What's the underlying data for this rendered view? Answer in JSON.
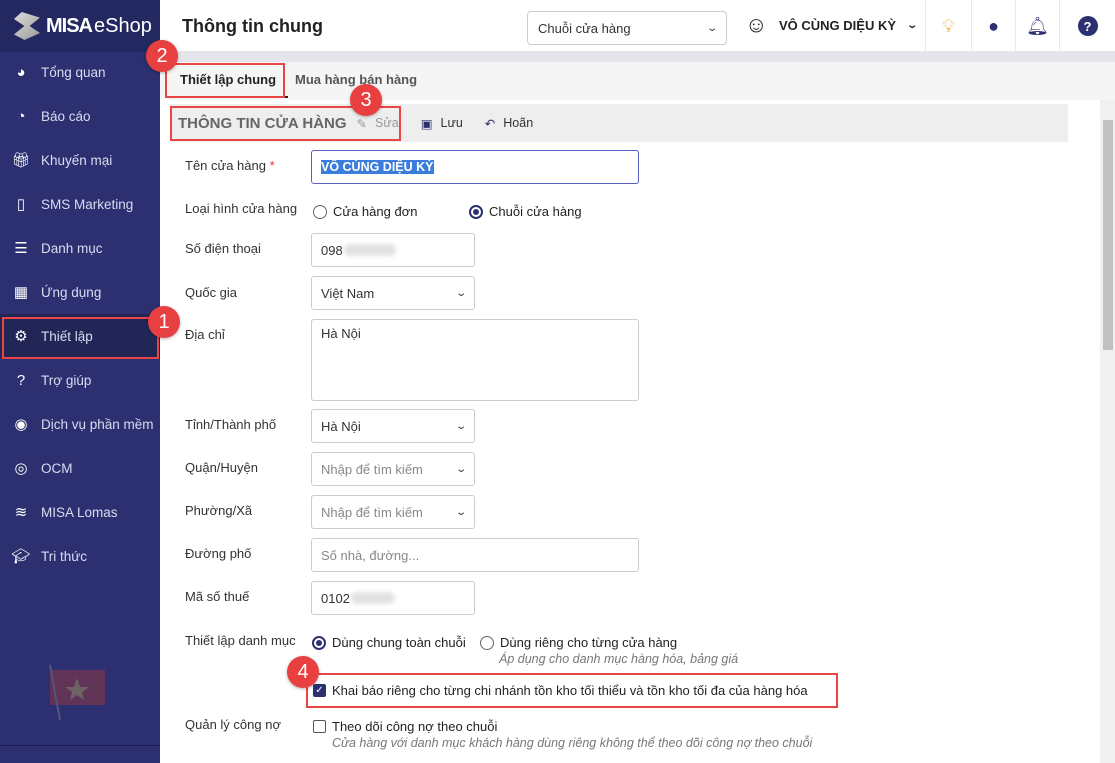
{
  "app": {
    "logo_bold": "MISA",
    "logo_light": "eShop"
  },
  "sidebar": {
    "items": [
      {
        "label": "Tổng quan",
        "icon": "dashboard-icon"
      },
      {
        "label": "Báo cáo",
        "icon": "pie-chart-icon"
      },
      {
        "label": "Khuyến mại",
        "icon": "gift-icon"
      },
      {
        "label": "SMS Marketing",
        "icon": "phone-icon"
      },
      {
        "label": "Danh mục",
        "icon": "list-icon"
      },
      {
        "label": "Ứng dụng",
        "icon": "apps-icon"
      },
      {
        "label": "Thiết lập",
        "icon": "gear-icon",
        "active": true
      },
      {
        "label": "Trợ giúp",
        "icon": "help-icon"
      },
      {
        "label": "Dịch vụ phần mềm",
        "icon": "user-icon"
      },
      {
        "label": "OCM",
        "icon": "ocm-icon"
      },
      {
        "label": "MISA Lomas",
        "icon": "layers-icon"
      },
      {
        "label": "Tri thức",
        "icon": "graduation-cap-icon"
      }
    ]
  },
  "header": {
    "title": "Thông tin chung",
    "chain_select": "Chuỗi cửa hàng",
    "user_name": "VÔ CÙNG DIỆU KỲ"
  },
  "tabs": [
    {
      "label": "Thiết lập chung",
      "active": true
    },
    {
      "label": "Mua hàng bán hàng"
    }
  ],
  "section": {
    "title": "THÔNG TIN CỬA HÀNG",
    "edit": "Sửa",
    "save": "Lưu",
    "undo": "Hoãn"
  },
  "form": {
    "store_name": {
      "label": "Tên cửa hàng",
      "required": "*",
      "value": "VÔ CÙNG DIỆU KỲ"
    },
    "store_type": {
      "label": "Loại hình cửa hàng",
      "options": [
        "Cửa hàng đơn",
        "Chuỗi cửa hàng"
      ],
      "selected": "Chuỗi cửa hàng"
    },
    "phone": {
      "label": "Số điện thoại",
      "value": "098"
    },
    "country": {
      "label": "Quốc gia",
      "value": "Việt Nam"
    },
    "address": {
      "label": "Địa chỉ",
      "value": "Hà Nội"
    },
    "province": {
      "label": "Tỉnh/Thành phố",
      "value": "Hà Nội"
    },
    "district": {
      "label": "Quận/Huyện",
      "placeholder": "Nhập để tìm kiếm"
    },
    "ward": {
      "label": "Phường/Xã",
      "placeholder": "Nhập để tìm kiếm"
    },
    "street": {
      "label": "Đường phố",
      "placeholder": "Số nhà, đường..."
    },
    "tax": {
      "label": "Mã số thuế",
      "value": "0102"
    },
    "catalog": {
      "label": "Thiết lập danh mục",
      "options": [
        "Dùng chung toàn chuỗi",
        "Dùng riêng cho từng cửa hàng"
      ],
      "selected": "Dùng chung toàn chuỗi",
      "hint": "Áp dụng cho danh mục hàng hóa, bảng giá",
      "stock_checkbox": "Khai báo riêng cho từng chi nhánh tồn kho tối thiểu và tồn kho tối đa của hàng hóa",
      "stock_checked": true
    },
    "debt": {
      "label": "Quản lý công nợ",
      "checkbox": "Theo dõi công nợ theo chuỗi",
      "checked": false,
      "hint": "Cửa hàng với danh mục khách hàng dùng riêng không thể theo dõi công nợ theo chuỗi"
    }
  },
  "annotations": [
    "1",
    "2",
    "3",
    "4"
  ],
  "colors": {
    "sidebar": "#2c3070",
    "accent": "#2c3070",
    "annotation": "#e84040",
    "lightbulb": "#f5a623"
  }
}
